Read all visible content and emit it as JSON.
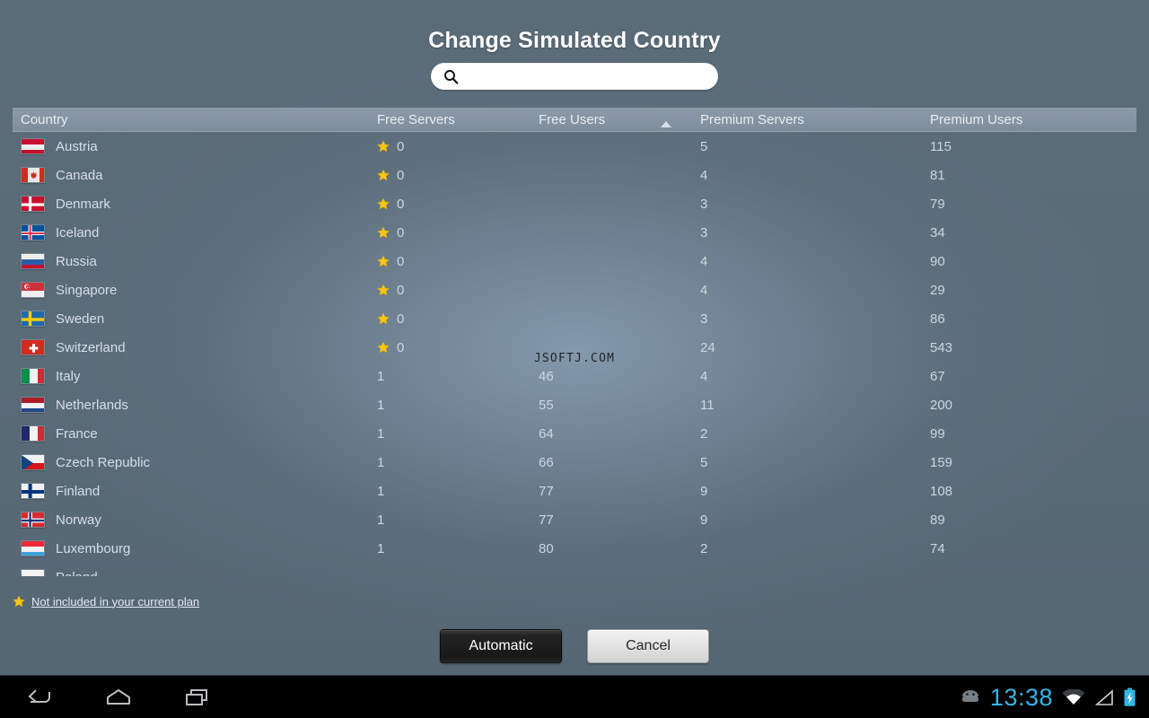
{
  "dialog": {
    "title": "Change Simulated Country"
  },
  "search": {
    "icon": "search-icon",
    "value": "",
    "placeholder": ""
  },
  "table": {
    "columns": [
      {
        "key": "country",
        "label": "Country",
        "sorted": false
      },
      {
        "key": "free_servers",
        "label": "Free Servers",
        "sorted": false
      },
      {
        "key": "free_users",
        "label": "Free Users",
        "sorted": true,
        "sort_direction": "ascending",
        "sort_icon": "sort-ascending-icon"
      },
      {
        "key": "premium_servers",
        "label": "Premium Servers",
        "sorted": false
      },
      {
        "key": "premium_users",
        "label": "Premium Users",
        "sorted": false
      }
    ],
    "rows": [
      {
        "country": "Austria",
        "flag": "flag-austria",
        "star": true,
        "free_servers": "0",
        "free_users": "",
        "premium_servers": "5",
        "premium_users": "115"
      },
      {
        "country": "Canada",
        "flag": "flag-canada",
        "star": true,
        "free_servers": "0",
        "free_users": "",
        "premium_servers": "4",
        "premium_users": "81"
      },
      {
        "country": "Denmark",
        "flag": "flag-denmark",
        "star": true,
        "free_servers": "0",
        "free_users": "",
        "premium_servers": "3",
        "premium_users": "79"
      },
      {
        "country": "Iceland",
        "flag": "flag-iceland",
        "star": true,
        "free_servers": "0",
        "free_users": "",
        "premium_servers": "3",
        "premium_users": "34"
      },
      {
        "country": "Russia",
        "flag": "flag-russia",
        "star": true,
        "free_servers": "0",
        "free_users": "",
        "premium_servers": "4",
        "premium_users": "90"
      },
      {
        "country": "Singapore",
        "flag": "flag-singapore",
        "star": true,
        "free_servers": "0",
        "free_users": "",
        "premium_servers": "4",
        "premium_users": "29"
      },
      {
        "country": "Sweden",
        "flag": "flag-sweden",
        "star": true,
        "free_servers": "0",
        "free_users": "",
        "premium_servers": "3",
        "premium_users": "86"
      },
      {
        "country": "Switzerland",
        "flag": "flag-switzerland",
        "star": true,
        "free_servers": "0",
        "free_users": "",
        "premium_servers": "24",
        "premium_users": "543"
      },
      {
        "country": "Italy",
        "flag": "flag-italy",
        "star": false,
        "free_servers": "1",
        "free_users": "46",
        "premium_servers": "4",
        "premium_users": "67"
      },
      {
        "country": "Netherlands",
        "flag": "flag-netherlands",
        "star": false,
        "free_servers": "1",
        "free_users": "55",
        "premium_servers": "11",
        "premium_users": "200"
      },
      {
        "country": "France",
        "flag": "flag-france",
        "star": false,
        "free_servers": "1",
        "free_users": "64",
        "premium_servers": "2",
        "premium_users": "99"
      },
      {
        "country": "Czech Republic",
        "flag": "flag-czech-republic",
        "star": false,
        "free_servers": "1",
        "free_users": "66",
        "premium_servers": "5",
        "premium_users": "159"
      },
      {
        "country": "Finland",
        "flag": "flag-finland",
        "star": false,
        "free_servers": "1",
        "free_users": "77",
        "premium_servers": "9",
        "premium_users": "108"
      },
      {
        "country": "Norway",
        "flag": "flag-norway",
        "star": false,
        "free_servers": "1",
        "free_users": "77",
        "premium_servers": "9",
        "premium_users": "89"
      },
      {
        "country": "Luxembourg",
        "flag": "flag-luxembourg",
        "star": false,
        "free_servers": "1",
        "free_users": "80",
        "premium_servers": "2",
        "premium_users": "74"
      },
      {
        "country": "Poland",
        "flag": "flag-poland",
        "star": false,
        "free_servers": "",
        "free_users": "",
        "premium_servers": "",
        "premium_users": ""
      }
    ]
  },
  "watermark": "JSOFTJ.COM",
  "plan_note": {
    "icon": "star-icon",
    "text": "Not included in your current plan"
  },
  "buttons": {
    "automatic": "Automatic",
    "cancel": "Cancel"
  },
  "system_bar": {
    "nav": [
      {
        "name": "back-icon",
        "label": "Back"
      },
      {
        "name": "home-icon",
        "label": "Home"
      },
      {
        "name": "recents-icon",
        "label": "Recent apps"
      }
    ],
    "android_icon": "android-robot-icon",
    "clock": "13:38",
    "wifi_icon": "wifi-icon",
    "signal_icon": "signal-icon",
    "battery_icon": "battery-charging-icon"
  },
  "colors": {
    "accent_blue": "#35b5e5",
    "star_yellow": "#f5c518",
    "background": "#5a6b78",
    "header_row": "#8694a3",
    "text_primary": "#d5dfe7"
  }
}
